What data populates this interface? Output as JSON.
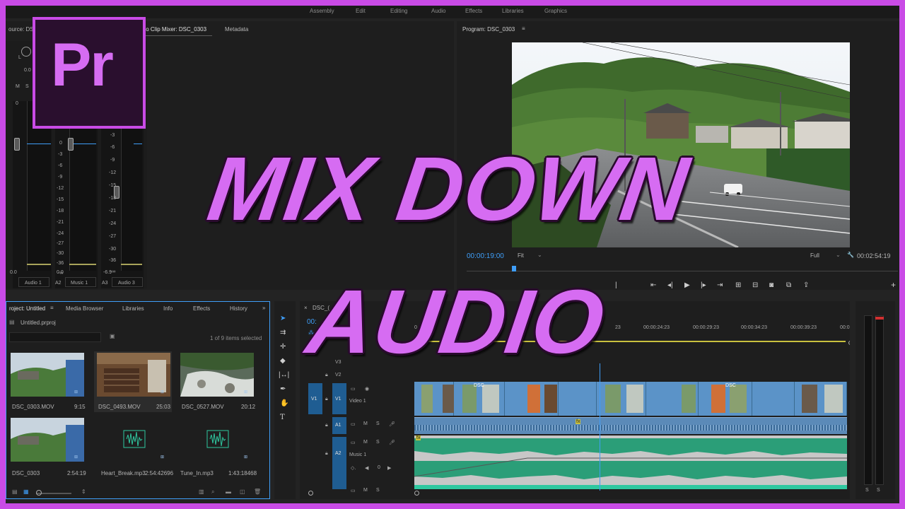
{
  "top_menu": [
    "Assembly",
    "Edit",
    "Editing",
    "Audio",
    "Effects",
    "Libraries",
    "Graphics"
  ],
  "logo": {
    "text": "Pr"
  },
  "overlay": {
    "line1": "MIX DOWN",
    "line2": "AUDIO"
  },
  "source_panel": {
    "tabs": [
      "ource: DS",
      "dio Clip Mixer: DSC_0303",
      "Metadata"
    ],
    "knob_label": "L",
    "value_top": "0.0",
    "ms": [
      "M",
      "S"
    ],
    "scale": [
      "0",
      "-3",
      "-6",
      "-9",
      "-12",
      "-15",
      "-18",
      "-21",
      "-24",
      "-27",
      "-30",
      "-36",
      "-∞"
    ],
    "scale_a3": [
      "6",
      "3",
      "0",
      "-3",
      "-6",
      "-9",
      "-12",
      "-15",
      "-18",
      "-21",
      "-24",
      "-27",
      "-30",
      "-36",
      "-∞"
    ],
    "channel_values": [
      "0.0",
      "0.0",
      "-6.9"
    ],
    "channels": [
      {
        "id": "",
        "name": "Audio 1"
      },
      {
        "id": "A2",
        "name": "Music 1"
      },
      {
        "id": "A3",
        "name": "Audio 3"
      }
    ]
  },
  "program_panel": {
    "title": "Program: DSC_0303",
    "timecode": "00:00:19:00",
    "fit": "Fit",
    "quality": "Full",
    "duration": "00:02:54:19"
  },
  "project_panel": {
    "tabs": [
      "roject: Untitled",
      "Media Browser",
      "Libraries",
      "Info",
      "Effects",
      "History"
    ],
    "file": "Untitled.prproj",
    "items_selected": "1 of 9 items selected",
    "items": [
      {
        "name": "DSC_0303.MOV",
        "duration": "9:15"
      },
      {
        "name": "DSC_0493.MOV",
        "duration": "25:03"
      },
      {
        "name": "DSC_0527.MOV",
        "duration": "20:12"
      },
      {
        "name": "DSC_0303",
        "duration": "2:54:19"
      },
      {
        "name": "Heart_Break.mp3",
        "duration": "2:54:42696"
      },
      {
        "name": "Tune_In.mp3",
        "duration": "1:43:18468"
      }
    ]
  },
  "timeline": {
    "tab": "DSC_(",
    "timecode": "00:",
    "ruler": [
      "00:00:24:23",
      "00:00:29:23",
      "00:00:34:23",
      "00:00:39:23",
      "00:0"
    ],
    "ruler_partial": [
      "0",
      "0",
      ":23",
      "23"
    ],
    "tracks": [
      {
        "id": "V3",
        "name": ""
      },
      {
        "id": "V2",
        "name": ""
      },
      {
        "src": "V1",
        "id": "V1",
        "name": "Video 1"
      },
      {
        "id": "A1",
        "name": ""
      },
      {
        "id": "A2",
        "name": "Music 1"
      }
    ],
    "track_buttons": [
      "M",
      "S"
    ],
    "clip_label": "DSC",
    "fx_label": "fx",
    "volume_value": "0",
    "meter_labels": [
      "S",
      "S"
    ]
  },
  "colors": {
    "accent": "#3f9ef8",
    "brand": "#c94be6",
    "video_clip": "#5b93c8",
    "audio_clip": "#2b9e78"
  }
}
